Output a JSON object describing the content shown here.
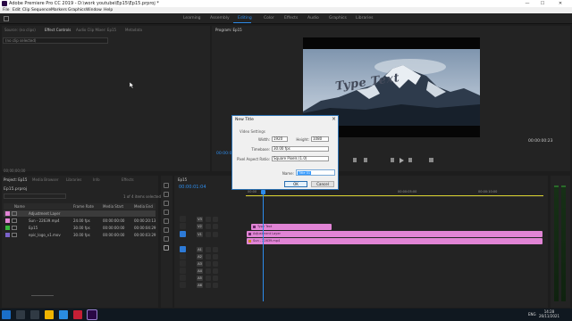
{
  "window": {
    "title": "Adobe Premiere Pro CC 2019 - D:\\work youtube\\Ep15\\Ep15.prproj *",
    "controls": {
      "minimize": "—",
      "maximize": "☐",
      "close": "✕"
    }
  },
  "menu": [
    "File",
    "Edit",
    "Clip",
    "Sequence",
    "Markers",
    "Graphics",
    "Window",
    "Help"
  ],
  "workspaces": {
    "items": [
      "Learning",
      "Assembly",
      "Editing",
      "Color",
      "Effects",
      "Audio",
      "Graphics",
      "Libraries"
    ],
    "active": "Editing",
    "active_color": "#2d8ceb"
  },
  "source_panel": {
    "tabs": [
      "Source: (no clips)",
      "Effect Controls",
      "Audio Clip Mixer: Ep15",
      "Metadata"
    ],
    "clip_dropdown": "(no clip selected)",
    "timecode": "00;00;00;00"
  },
  "program_panel": {
    "tab": "Program: Ep15",
    "overlay_text": "Type Text",
    "timecode": "00:00:00:23",
    "left_timecode": "00:00:01:04"
  },
  "project_panel": {
    "tabs": [
      "Project: Ep15",
      "Media Browser",
      "Libraries",
      "Info",
      "Effects"
    ],
    "project_name": "Ep15.prproj",
    "items_count": "1 of 4 items selected",
    "columns": [
      "Name",
      "Frame Rate",
      "Media Start",
      "Media End"
    ],
    "rows": [
      {
        "name": "Adjustment Layer",
        "frame_rate": "",
        "media_start": "",
        "media_end": "",
        "color": "#e184d5",
        "selected": true
      },
      {
        "name": "Sun - 22639.mp4",
        "frame_rate": "24.00 fps",
        "media_start": "00:00:00:00",
        "media_end": "00:00:20:13",
        "color": "#e184d5",
        "selected": false
      },
      {
        "name": "Ep15",
        "frame_rate": "30.00 fps",
        "media_start": "00:00:00:00",
        "media_end": "00:00:04:29",
        "color": "#38b53d",
        "selected": false
      },
      {
        "name": "epic_logo_v1.mov",
        "frame_rate": "30.00 fps",
        "media_start": "00:00:00:00",
        "media_end": "00:00:03:29",
        "color": "#7a62c9",
        "selected": false
      }
    ]
  },
  "timeline": {
    "tab": "Ep15",
    "timecode": "00:00:01:04",
    "ruler": [
      "00:00",
      "00:00:05:00",
      "00:00:10:00"
    ],
    "video_tracks": [
      "V3",
      "V2",
      "V1"
    ],
    "audio_tracks": [
      "A1",
      "A2",
      "A3",
      "A4",
      "A5",
      "A6",
      "Master"
    ],
    "clips": [
      {
        "label": "Type Text",
        "color": "#e184d5"
      },
      {
        "label": "Adjustment Layer",
        "color": "#e184d5"
      },
      {
        "label": "Sun - 22639.mp4",
        "color": "#e184d5"
      }
    ]
  },
  "dialog": {
    "title": "New Title",
    "section": "Video Settings",
    "width_label": "Width:",
    "width_value": "1920",
    "height_label": "Height:",
    "height_value": "1080",
    "timebase_label": "Timebase:",
    "timebase_value": "30.00 fps",
    "par_label": "Pixel Aspect Ratio:",
    "par_value": "Square Pixels (1.0)",
    "name_label": "Name:",
    "name_value": "Title 01",
    "ok_label": "OK",
    "cancel_label": "Cancel"
  },
  "taskbar": {
    "lang": "ENG",
    "time": "14:28",
    "date": "26/11/2021"
  }
}
